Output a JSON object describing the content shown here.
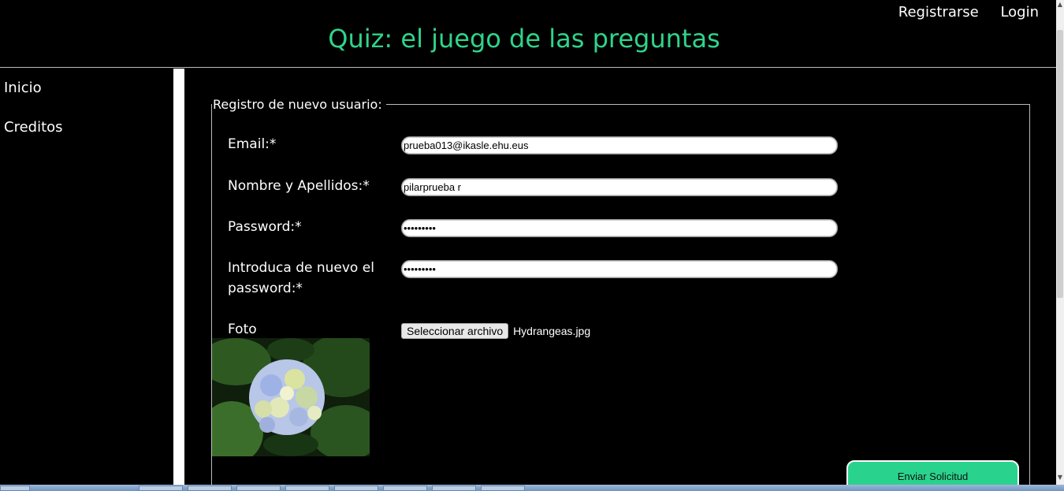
{
  "header": {
    "title": "Quiz: el juego de las preguntas",
    "links": {
      "register": "Registrarse",
      "login": "Login"
    }
  },
  "sidebar": {
    "items": [
      {
        "label": "Inicio"
      },
      {
        "label": "Creditos"
      }
    ]
  },
  "form": {
    "legend": "Registro de nuevo usuario:",
    "email": {
      "label": "Email:*",
      "value": "prueba013@ikasle.ehu.eus"
    },
    "name": {
      "label": "Nombre y Apellidos:*",
      "value": "pilarprueba r"
    },
    "password": {
      "label": "Password:*",
      "value": "•••••••••"
    },
    "password_repeat": {
      "label": "Introduca de nuevo el password:*",
      "value": "•••••••••"
    },
    "photo": {
      "label": "Foto",
      "button_label": "Seleccionar archivo",
      "file_name": "Hydrangeas.jpg"
    },
    "submit_label": "Enviar Solicitud"
  },
  "colors": {
    "title": "#2fd48a",
    "submit_bg": "#2ad38d",
    "background": "#000000"
  }
}
